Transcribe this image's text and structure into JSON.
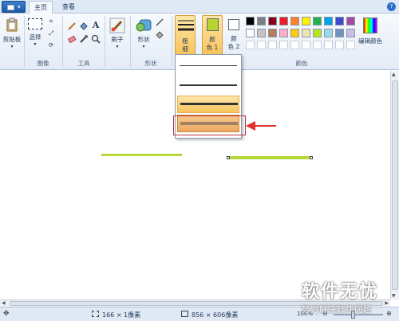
{
  "tabs": {
    "home": "主页",
    "view": "查看"
  },
  "ribbon": {
    "clipboard": {
      "paste_label": "剪贴板"
    },
    "image": {
      "select_label": "选择",
      "group_label": "图像"
    },
    "tools": {
      "group_label": "工具",
      "text_tool": "A"
    },
    "brushes": {
      "label": "刷子"
    },
    "shapes": {
      "label": "形状",
      "group_label": "形状"
    },
    "size": {
      "label_line1": "粗",
      "label_line2": "细"
    },
    "color1": {
      "line1": "颜",
      "line2": "色 1",
      "value": "#b8d432"
    },
    "color2": {
      "line1": "颜",
      "line2": "色 2",
      "value": "#ffffff"
    },
    "colors": {
      "group_label": "颜色",
      "edit_label": "编辑颜色",
      "palette_row1": [
        "#000000",
        "#7f7f7f",
        "#880015",
        "#ed1c24",
        "#ff7f27",
        "#fff200",
        "#22b14c",
        "#00a2e8",
        "#3f48cc",
        "#a349a4"
      ],
      "palette_row2": [
        "#ffffff",
        "#c3c3c3",
        "#b97a57",
        "#ffaec9",
        "#ffc90e",
        "#efe4b0",
        "#b5e61d",
        "#99d9ea",
        "#7092be",
        "#c8bfe7"
      ]
    }
  },
  "dropdown": {
    "options": [
      "1px",
      "3px",
      "5px",
      "8px"
    ],
    "selected_index": 3
  },
  "canvas": {
    "stroke_color": "#b5d93a"
  },
  "status": {
    "selection_size": "166 × 1像素",
    "canvas_size": "856 × 606像素",
    "zoom": "100%"
  },
  "watermark": {
    "line1": "软件无忧",
    "line2": "努力解决软件问题"
  }
}
